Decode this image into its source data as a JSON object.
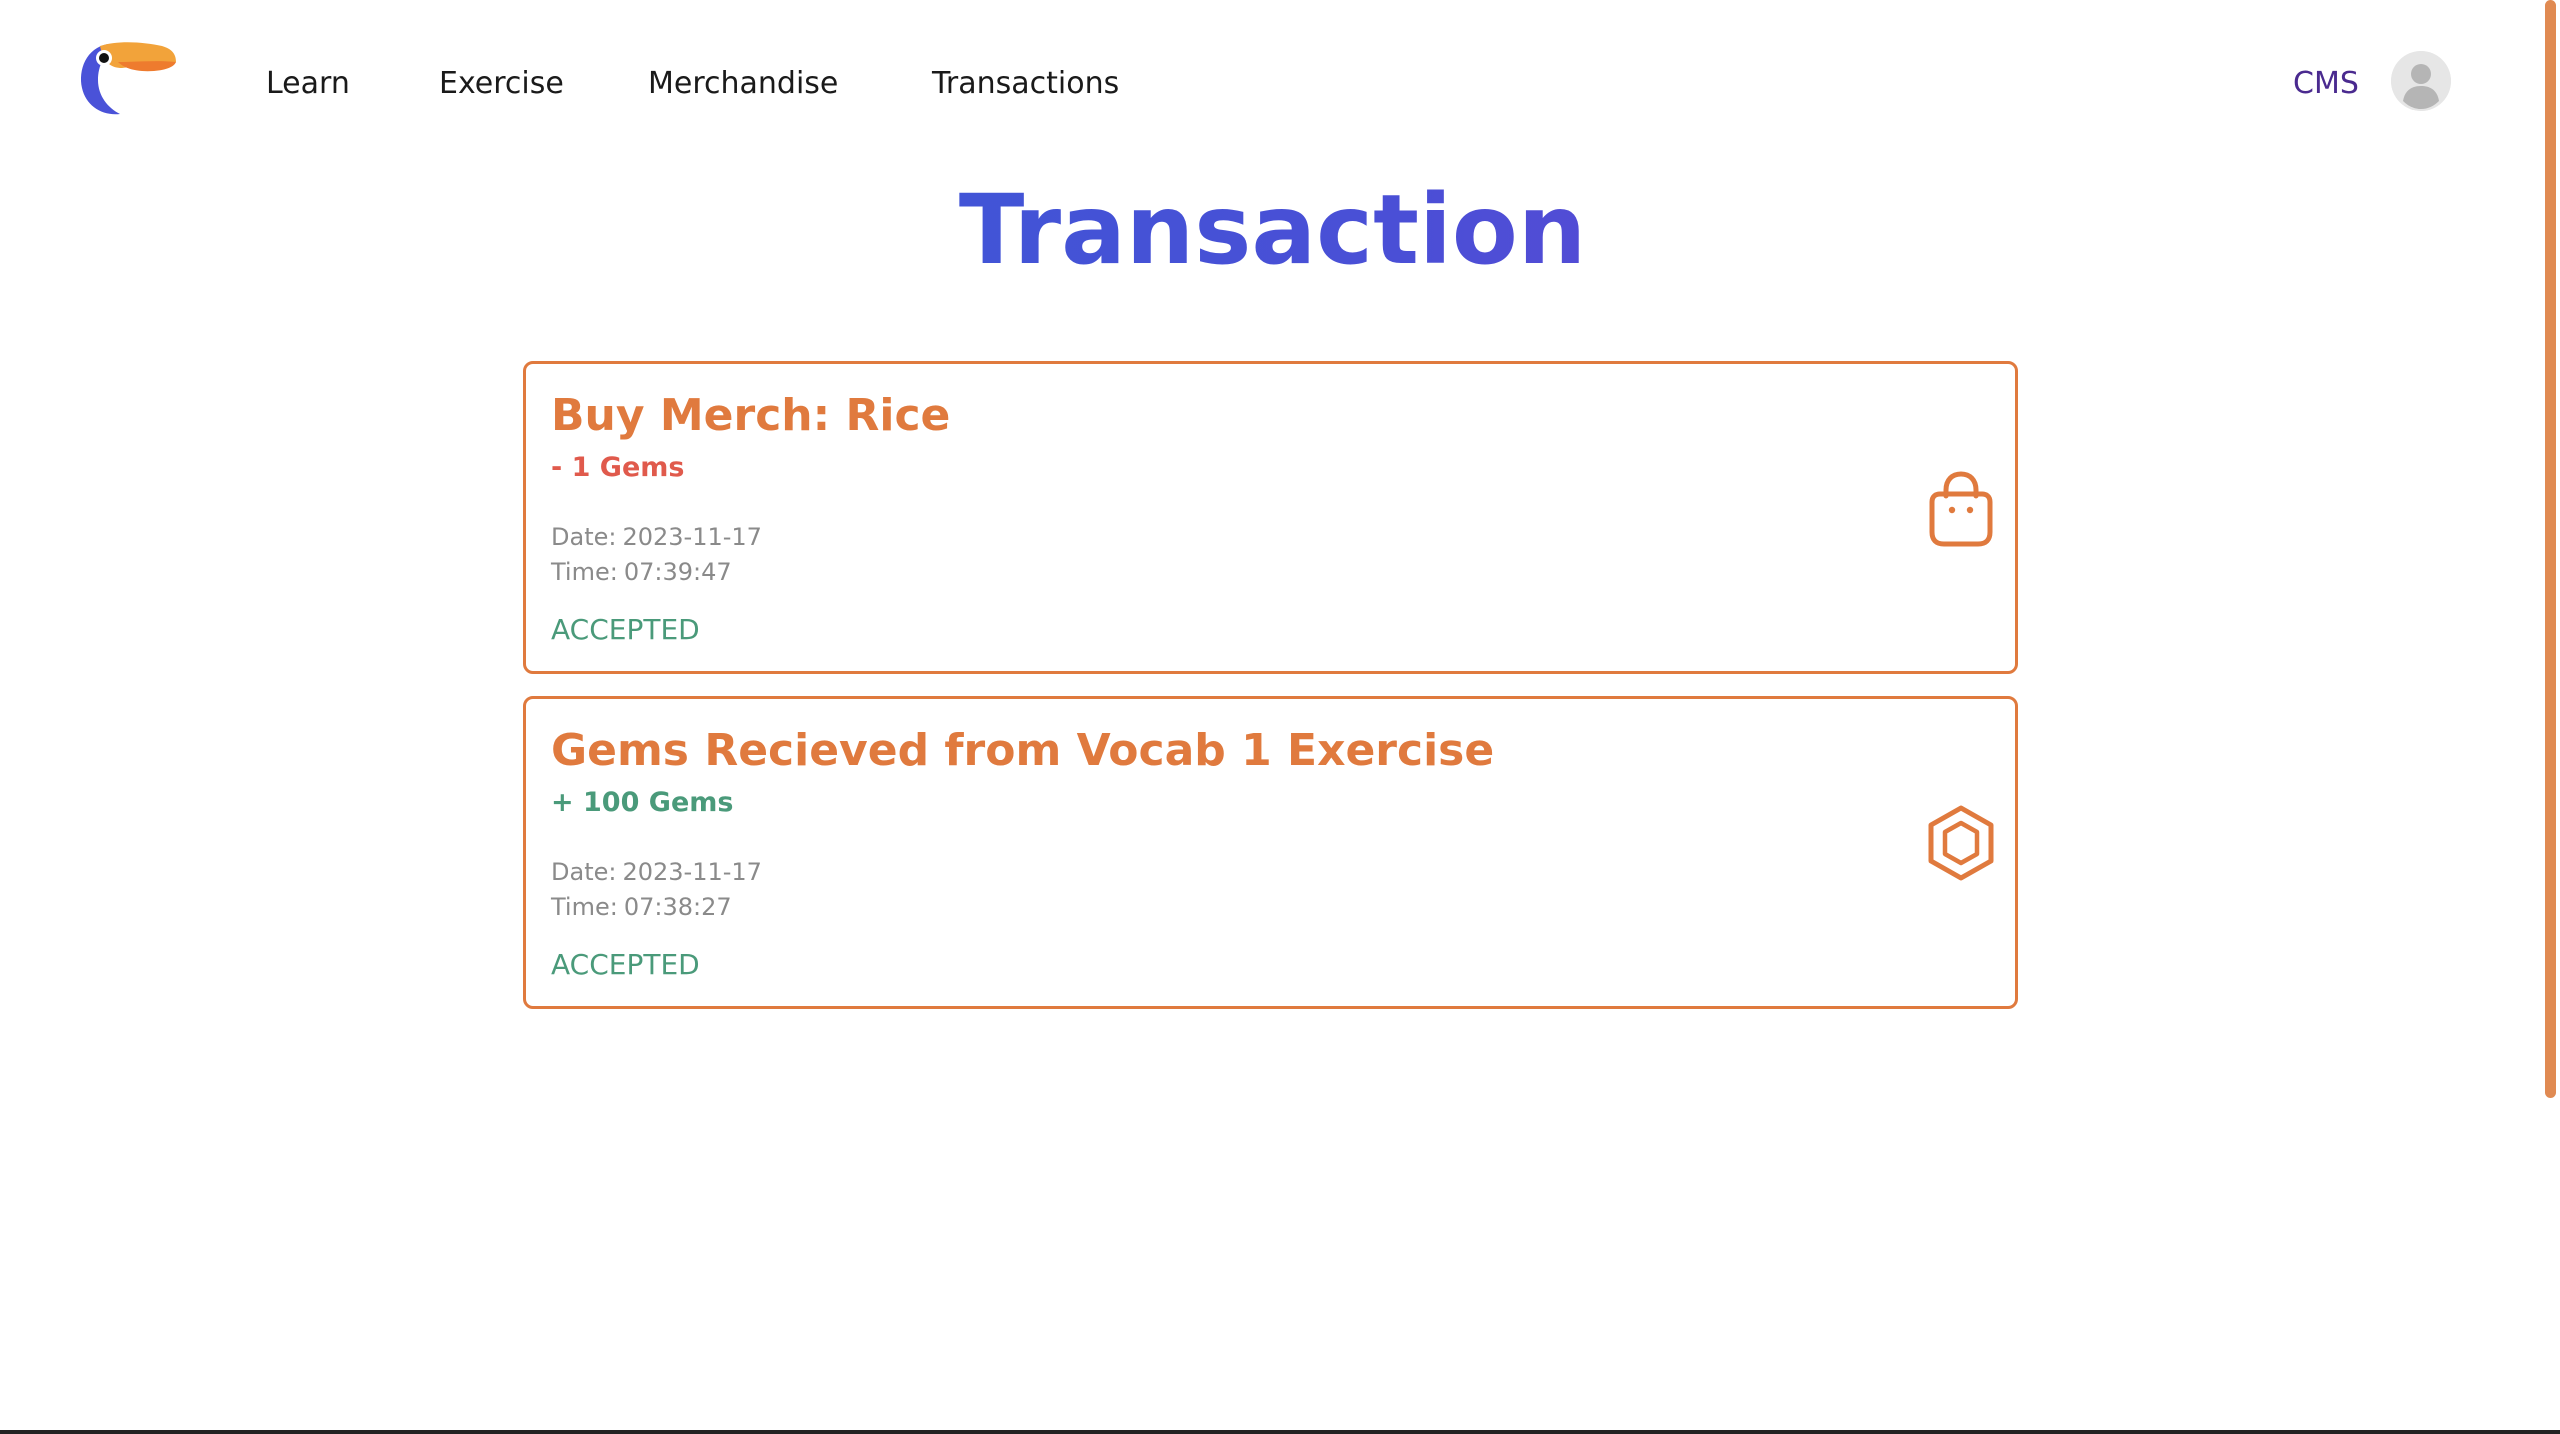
{
  "nav": {
    "logo": "toucan-logo",
    "links": [
      "Learn",
      "Exercise",
      "Merchandise",
      "Transactions"
    ],
    "cms": "CMS",
    "avatar": "user-avatar-icon"
  },
  "page": {
    "title": "Transaction"
  },
  "transactions": [
    {
      "title": "Buy Merch: Rice",
      "amount": "- 1 Gems",
      "date_label": "Date:",
      "date": "2023-11-17",
      "time_label": "Time:",
      "time": "07:39:47",
      "status": "ACCEPTED",
      "icon": "shopping-bag-icon"
    },
    {
      "title": "Gems Recieved from Vocab 1 Exercise",
      "amount": "+ 100 Gems",
      "date_label": "Date:",
      "date": "2023-11-17",
      "time_label": "Time:",
      "time": "07:38:27",
      "status": "ACCEPTED",
      "icon": "gem-icon"
    }
  ],
  "colors": {
    "accent": "#e07a3e",
    "negative": "#e05a4c",
    "positive": "#4a9a7a",
    "title_gradient_start": "#2f5fd8",
    "title_gradient_end": "#7a3fd0",
    "cms": "#4a2a8f"
  }
}
